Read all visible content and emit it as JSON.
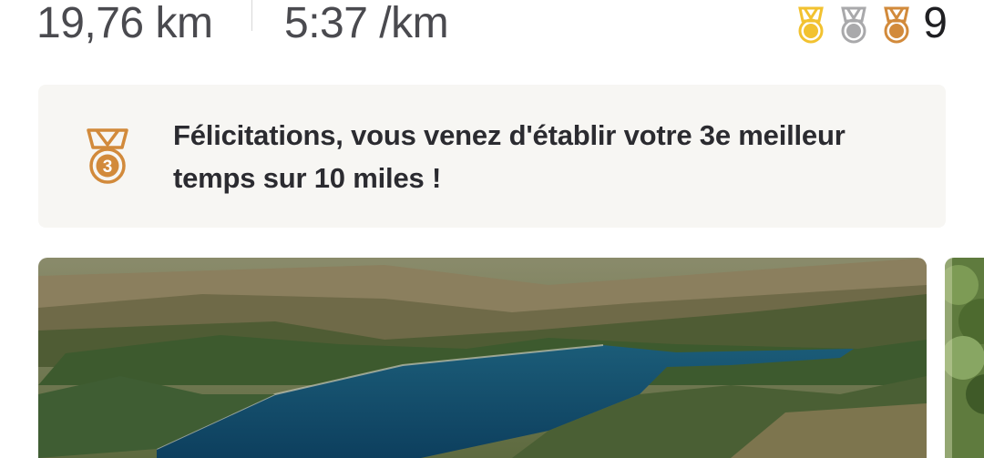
{
  "stats": {
    "distance": "19,76 km",
    "pace": "5:37 /km"
  },
  "medals": {
    "icons": [
      "gold-medal-icon",
      "silver-medal-icon",
      "bronze-medal-icon"
    ],
    "count": "9"
  },
  "achievement": {
    "icon": "bronze-medal-3-icon",
    "medal_rank": "3",
    "text": "Félicitations, vous venez d'établir votre 3e meilleur temps sur 10 miles !"
  },
  "colors": {
    "gold": "#f2c230",
    "silver": "#a9a9ab",
    "bronze": "#d28a3b",
    "banner_bg": "#f7f6f3"
  },
  "photos": {
    "items": [
      "aerial-lake-photo",
      "trees-photo"
    ]
  }
}
